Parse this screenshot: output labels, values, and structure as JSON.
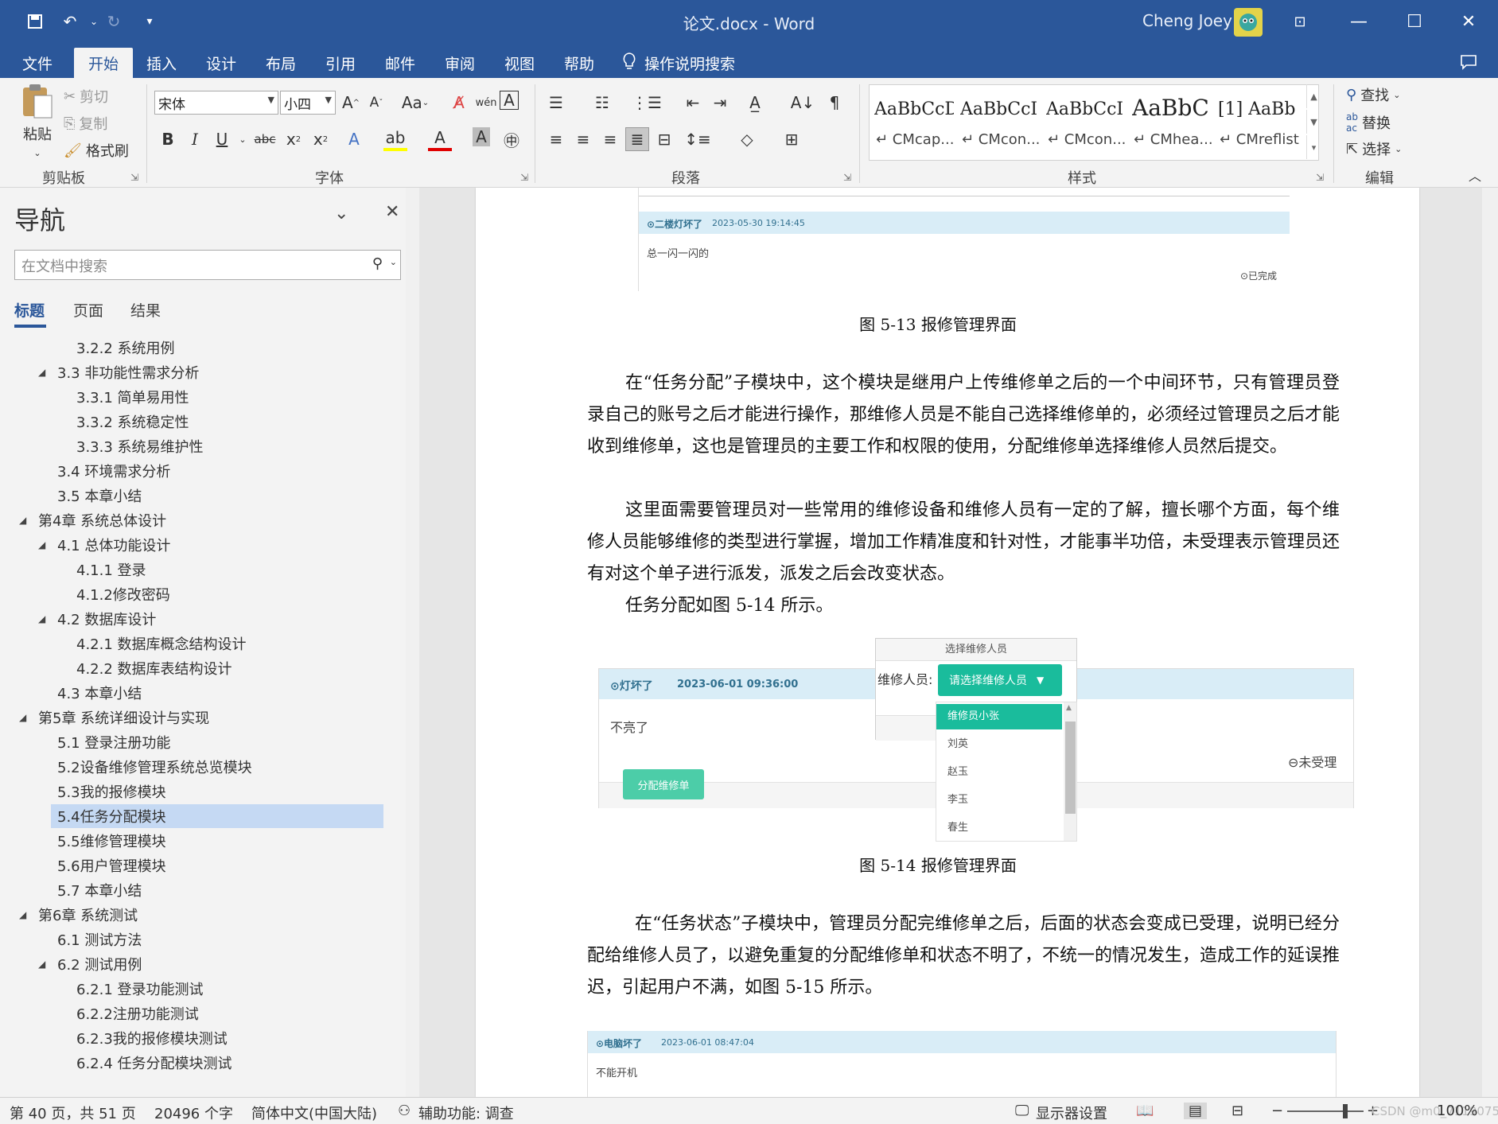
{
  "window": {
    "doc_title": "论文.docx  -  Word",
    "user_name": "Cheng Joey",
    "quick_access": [
      "save-icon",
      "undo-icon",
      "redo-icon",
      "customize-icon"
    ]
  },
  "tabs": [
    "文件",
    "开始",
    "插入",
    "设计",
    "布局",
    "引用",
    "邮件",
    "审阅",
    "视图",
    "帮助"
  ],
  "tell_me": "操作说明搜索",
  "ribbon": {
    "clipboard": {
      "paste": "粘贴",
      "cut": "剪切",
      "copy": "复制",
      "format_painter": "格式刷",
      "label": "剪贴板"
    },
    "font": {
      "name": "宋体",
      "size": "小四",
      "label": "字体"
    },
    "paragraph": {
      "label": "段落"
    },
    "styles": {
      "label": "样式",
      "items": [
        {
          "preview": "AaBbCcDd",
          "name": "↵ CMcap..."
        },
        {
          "preview": "AaBbCcI",
          "name": "↵ CMcon..."
        },
        {
          "preview": "AaBbCcI",
          "name": "↵ CMcon..."
        },
        {
          "preview": "AaBbC",
          "name": "↵ CMhea..."
        },
        {
          "preview": "[1]  AaBb",
          "name": "↵ CMreflist"
        }
      ]
    },
    "editing": {
      "find": "查找",
      "replace": "替换",
      "select": "选择",
      "label": "编辑"
    }
  },
  "nav": {
    "title": "导航",
    "search_placeholder": "在文档中搜索",
    "tabs": [
      "标题",
      "页面",
      "结果"
    ],
    "headings": [
      {
        "text": "3.2.2 系统用例",
        "level": 3,
        "expand": false
      },
      {
        "text": "3.3 非功能性需求分析",
        "level": 2,
        "expand": true
      },
      {
        "text": "3.3.1 简单易用性",
        "level": 3,
        "expand": false
      },
      {
        "text": "3.3.2 系统稳定性",
        "level": 3,
        "expand": false
      },
      {
        "text": "3.3.3 系统易维护性",
        "level": 3,
        "expand": false
      },
      {
        "text": "3.4 环境需求分析",
        "level": 2,
        "expand": false
      },
      {
        "text": "3.5 本章小结",
        "level": 2,
        "expand": false
      },
      {
        "text": "第4章 系统总体设计",
        "level": 1,
        "expand": true
      },
      {
        "text": "4.1 总体功能设计",
        "level": 2,
        "expand": true
      },
      {
        "text": "4.1.1 登录",
        "level": 3,
        "expand": false
      },
      {
        "text": "4.1.2修改密码",
        "level": 3,
        "expand": false
      },
      {
        "text": "4.2 数据库设计",
        "level": 2,
        "expand": true
      },
      {
        "text": "4.2.1 数据库概念结构设计",
        "level": 3,
        "expand": false
      },
      {
        "text": "4.2.2 数据库表结构设计",
        "level": 3,
        "expand": false
      },
      {
        "text": "4.3 本章小结",
        "level": 2,
        "expand": false
      },
      {
        "text": "第5章 系统详细设计与实现",
        "level": 1,
        "expand": true
      },
      {
        "text": "5.1 登录注册功能",
        "level": 2,
        "expand": false
      },
      {
        "text": "5.2设备维修管理系统总览模块",
        "level": 2,
        "expand": false
      },
      {
        "text": "5.3我的报修模块",
        "level": 2,
        "expand": false
      },
      {
        "text": "5.4任务分配模块",
        "level": 2,
        "expand": false,
        "selected": true
      },
      {
        "text": "5.5维修管理模块",
        "level": 2,
        "expand": false
      },
      {
        "text": "5.6用户管理模块",
        "level": 2,
        "expand": false
      },
      {
        "text": "5.7 本章小结",
        "level": 2,
        "expand": false
      },
      {
        "text": "第6章 系统测试",
        "level": 1,
        "expand": true
      },
      {
        "text": "6.1 测试方法",
        "level": 2,
        "expand": false
      },
      {
        "text": "6.2 测试用例",
        "level": 2,
        "expand": true
      },
      {
        "text": "6.2.1 登录功能测试",
        "level": 3,
        "expand": false
      },
      {
        "text": "6.2.2注册功能测试",
        "level": 3,
        "expand": false
      },
      {
        "text": "6.2.3我的报修模块测试",
        "level": 3,
        "expand": false
      },
      {
        "text": "6.2.4 任务分配模块测试",
        "level": 3,
        "expand": false
      }
    ]
  },
  "document": {
    "fig13": {
      "header": "⊙二楼灯坏了",
      "time": "2023-05-30 19:14:45",
      "body": "总一闪一闪的",
      "status": "⊙已完成",
      "caption": "图 5-13 报修管理界面"
    },
    "para1": "在“任务分配”子模块中，这个模块是继用户上传维修单之后的一个中间环节，只有管理员登录自己的账号之后才能进行操作，那维修人员是不能自己选择维修单的，必须经过管理员之后才能收到维修单，这也是管理员的主要工作和权限的使用，分配维修单选择维修人员然后提交。",
    "para2": "这里面需要管理员对一些常用的维修设备和维修人员有一定的了解，擅长哪个方面，每个维修人员能够维修的类型进行掌握，增加工作精准度和针对性，才能事半功倍，未受理表示管理员还有对这个单子进行派发，派发之后会改变状态。",
    "para3": "任务分配如图 5-14 所示。",
    "fig14": {
      "header": "⊙灯坏了",
      "time": "2023-06-01 09:36:00",
      "body": "不亮了",
      "status": "⊖未受理",
      "assign_button": "分配维修单",
      "dialog_title": "选择维修人员",
      "dialog_label": "维修人员:",
      "select_button": "请选择维修人员",
      "options": [
        "维修员小张",
        "刘英",
        "赵玉",
        "李玉",
        "春生"
      ],
      "caption": "图 5-14 报修管理界面"
    },
    "para4": "在“任务状态”子模块中，管理员分配完维修单之后，后面的状态会变成已受理，说明已经分配给维修人员了，以避免重复的分配维修单和状态不明了，不统一的情况发生，造成工作的延误推迟，引起用户不满，如图 5-15 所示。",
    "fig15": {
      "header": "⊙电脑坏了",
      "time": "2023-06-01 08:47:04",
      "body": "不能开机"
    }
  },
  "status": {
    "page": "第 40 页，共 51 页",
    "words": "20496 个字",
    "language": "简体中文(中国大陆)",
    "accessibility": "辅助功能: 调查",
    "display": "显示器设置",
    "zoom": "100%",
    "watermark": "CSDN @m0_71190755"
  },
  "colors": {
    "accent": "#2b579a",
    "green": "#1abc9c"
  }
}
